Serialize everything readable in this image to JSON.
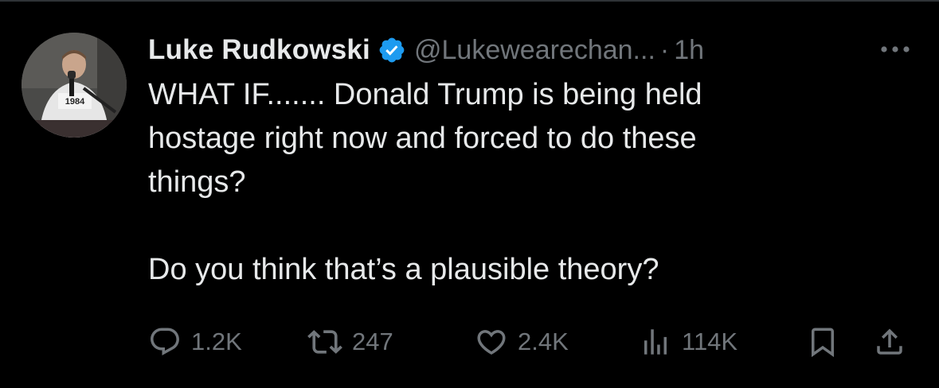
{
  "tweet": {
    "author": {
      "display_name": "Luke Rudkowski",
      "handle": "@Lukewearechan...",
      "verified": true,
      "avatar_icon": "profile-photo"
    },
    "separator": "·",
    "time": "1h",
    "text": "WHAT IF....... Donald Trump is being held\nhostage right now and forced to do these\nthings?\n\nDo you think that’s a plausible theory?",
    "actions": {
      "replies": "1.2K",
      "reposts": "247",
      "likes": "2.4K",
      "views": "114K"
    }
  },
  "colors": {
    "background": "#000000",
    "text_primary": "#e7e9ea",
    "text_secondary": "#71767b",
    "verified_badge": "#1d9bf0"
  },
  "icons": {
    "more": "more-horizontal-icon",
    "reply": "reply-bubble-icon",
    "repost": "repost-icon",
    "like": "heart-icon",
    "views": "views-bar-chart-icon",
    "bookmark": "bookmark-icon",
    "share": "share-upload-icon"
  }
}
